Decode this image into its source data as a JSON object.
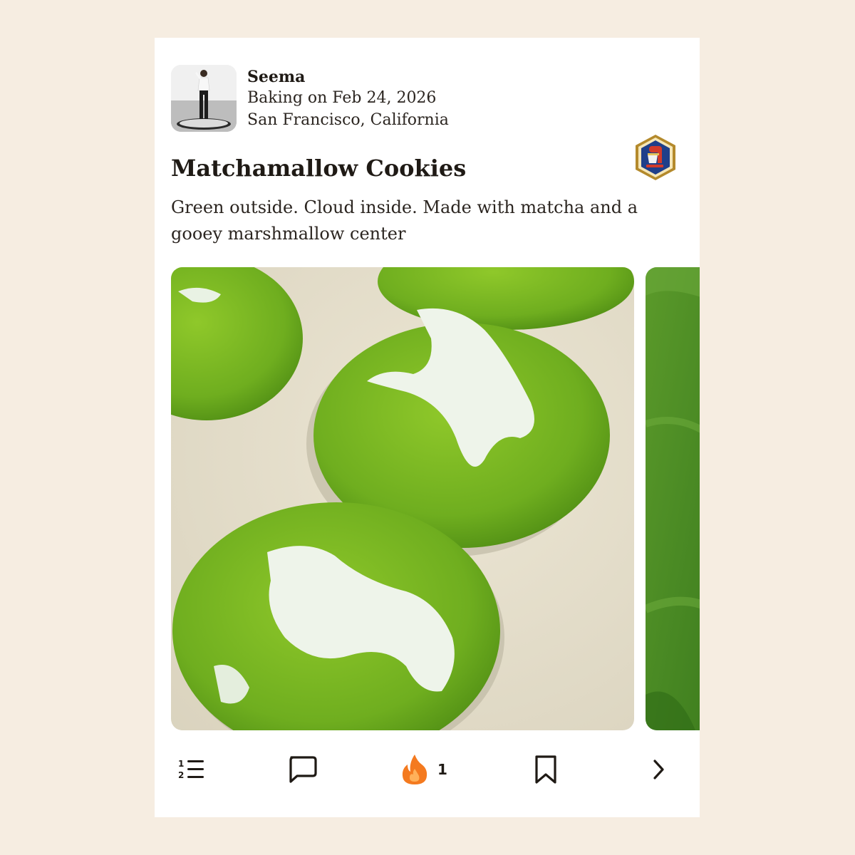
{
  "post": {
    "author": "Seema",
    "activity_date": "Baking on Feb 24, 2026",
    "location": "San Francisco, California",
    "title": "Matchamallow Cookies",
    "description": "Green outside. Cloud inside. Made with matcha and a gooey marshmallow center"
  },
  "badge": {
    "icon": "stand-mixer-badge-icon",
    "colors": {
      "outer": "#b48a2c",
      "inner": "#1f3f8a",
      "mixer": "#d23a2a"
    }
  },
  "media": {
    "photos": [
      {
        "depicts": "matcha-marshmallow-cookies"
      },
      {
        "depicts": "matcha-powder"
      }
    ]
  },
  "actions": {
    "list_icon": "numbered-list-icon",
    "comment_icon": "comment-icon",
    "fire_icon": "fire-icon",
    "fire_count": "1",
    "save_icon": "bookmark-icon",
    "next_icon": "chevron-right-icon"
  },
  "colors": {
    "page_background": "#f6ede1",
    "card_background": "#ffffff",
    "text": "#1f1a15",
    "fire": "#f47a1f"
  }
}
